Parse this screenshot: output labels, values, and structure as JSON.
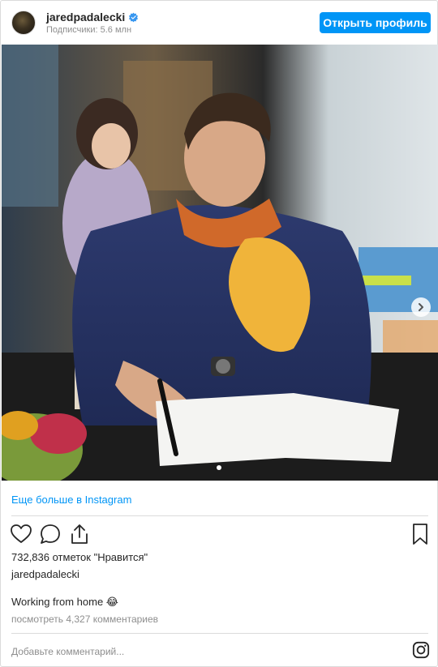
{
  "header": {
    "username": "jaredpadalecki",
    "followers": "Подписчики: 5.6 млн",
    "profile_button": "Открыть профиль"
  },
  "icons": {
    "verified": "verified-badge-icon",
    "next": "chevron-right-icon",
    "like": "heart-icon",
    "comment": "comment-icon",
    "share": "share-icon",
    "save": "bookmark-icon",
    "brand": "instagram-icon"
  },
  "colors": {
    "accent": "#0095f6",
    "muted": "#8e8e8e",
    "text": "#262626"
  },
  "more_link": "Еще больше в Instagram",
  "post": {
    "likes": "732,836 отметок \"Нравится\"",
    "author": "jaredpadalecki",
    "caption": "Working from home 😂",
    "comments_link": "посмотреть 4,327 комментариев"
  },
  "comment_box": {
    "placeholder": "Добавьте комментарий..."
  }
}
